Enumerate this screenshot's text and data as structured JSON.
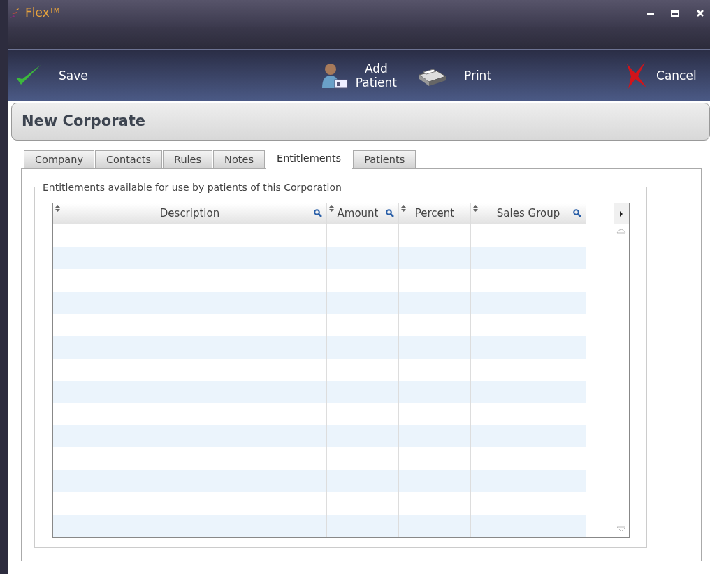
{
  "window": {
    "title": "Flex",
    "title_mark": "TM"
  },
  "toolbar": [
    {
      "kind": "save",
      "label": "Save"
    },
    {
      "kind": "add_patient",
      "label": "Add\nPatient"
    },
    {
      "kind": "print",
      "label": "Print"
    },
    {
      "kind": "cancel",
      "label": "Cancel"
    }
  ],
  "heading": "New Corporate",
  "tabs": [
    {
      "label": "Company",
      "selected": false
    },
    {
      "label": "Contacts",
      "selected": false
    },
    {
      "label": "Rules",
      "selected": false
    },
    {
      "label": "Notes",
      "selected": false
    },
    {
      "label": "Entitlements",
      "selected": true
    },
    {
      "label": "Patients",
      "selected": false
    }
  ],
  "group_title": "Entitlements available for use by patients of this Corporation",
  "table": {
    "columns": [
      {
        "label": "Description",
        "searchable": true
      },
      {
        "label": "Amount",
        "searchable": true
      },
      {
        "label": "Percent",
        "searchable": false
      },
      {
        "label": "Sales Group",
        "searchable": true
      }
    ]
  }
}
